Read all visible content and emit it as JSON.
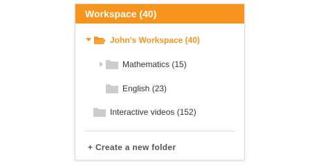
{
  "header": {
    "title": "Workspace (40)"
  },
  "tree": {
    "root": {
      "label": "John's Workspace (40)",
      "expanded": true
    },
    "children": [
      {
        "label": "Mathematics (15)",
        "has_children": true,
        "expanded": false
      },
      {
        "label": "English (23)",
        "has_children": false
      }
    ],
    "sibling": {
      "label": "Interactive videos (152)"
    }
  },
  "actions": {
    "create_folder": "+ Create a new folder"
  },
  "colors": {
    "accent": "#f7941d",
    "folder_gray": "#cccccc",
    "text": "#333333"
  },
  "icons": {
    "caret_open": "caret-down-icon",
    "caret_closed": "caret-right-icon",
    "folder_open": "folder-open-icon",
    "folder": "folder-icon"
  }
}
